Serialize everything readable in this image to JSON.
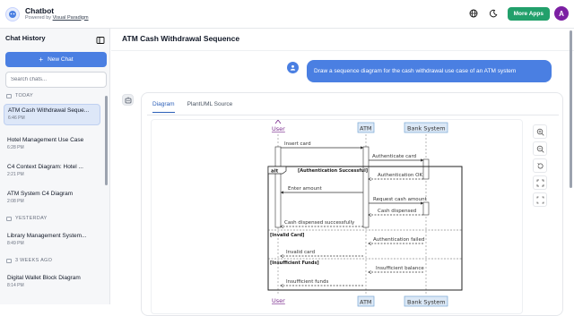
{
  "app": {
    "title": "Chatbot",
    "subtitle_prefix": "Powered by",
    "subtitle_link": "Visual Paradigm",
    "more_apps_label": "More Apps",
    "avatar_initial": "A"
  },
  "sidebar": {
    "heading": "Chat History",
    "new_chat_label": "New Chat",
    "search_placeholder": "Search chats...",
    "sections": [
      {
        "label": "TODAY",
        "chats": [
          {
            "title": "ATM Cash Withdrawal Seque...",
            "time": "6:46 PM",
            "active": true
          },
          {
            "title": "Hotel Management Use Case",
            "time": "6:28 PM"
          },
          {
            "title": "C4 Context Diagram: Hotel ...",
            "time": "2:21 PM"
          },
          {
            "title": "ATM System C4 Diagram",
            "time": "2:08 PM"
          }
        ]
      },
      {
        "label": "YESTERDAY",
        "chats": [
          {
            "title": "Library Management System...",
            "time": "8:49 PM"
          }
        ]
      },
      {
        "label": "3 WEEKS AGO",
        "chats": [
          {
            "title": "Digital Wallet Block Diagram",
            "time": "8:14 PM"
          }
        ]
      }
    ]
  },
  "main": {
    "title": "ATM Cash Withdrawal Sequence",
    "user_message": "Draw a sequence diagram for the cash withdrawal use case of an ATM system",
    "tabs": [
      {
        "label": "Diagram",
        "active": true
      },
      {
        "label": "PlantUML Source",
        "active": false
      }
    ],
    "tools": [
      "zoom-in-icon",
      "zoom-out-icon",
      "reset-icon",
      "fullscreen-icon",
      "fit-icon"
    ]
  },
  "diagram": {
    "participants": [
      "User",
      "ATM",
      "Bank System"
    ],
    "messages": [
      "Insert card",
      "Authenticate card",
      "Authentication OK",
      "Enter amount",
      "Request cash amount",
      "Cash dispensed",
      "Cash dispensed successfully",
      "Authentication failed",
      "Invalid card",
      "Insufficient balance",
      "Insufficient funds"
    ],
    "fragment_keyword": "alt",
    "guards": [
      "[Authentication Successful]",
      "[Invalid Card]",
      "[Insufficient Funds]"
    ]
  },
  "colors": {
    "accent": "#4a7fe2",
    "more_apps": "#22a06b",
    "avatar": "#7c1fa3",
    "active_chat": "#dde7f8",
    "participant_user": "#7b2d8e",
    "participant_box": "#dbe8f6"
  }
}
